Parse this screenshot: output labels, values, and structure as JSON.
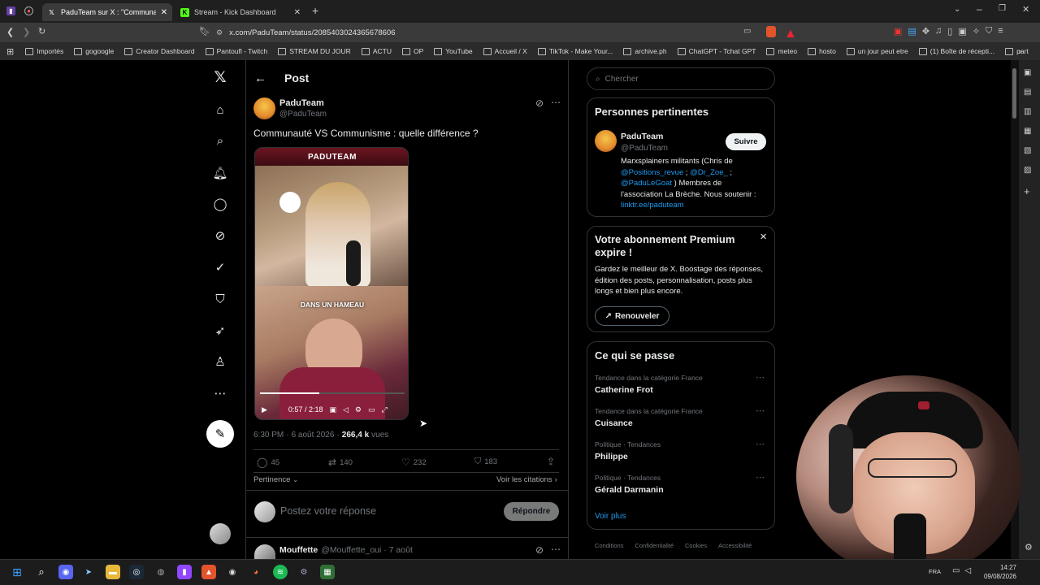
{
  "browser": {
    "tabs": [
      {
        "label": "PaduTeam sur X : \"Communa"
      },
      {
        "label": "Stream - Kick Dashboard"
      }
    ],
    "url": "x.com/PaduTeam/status/2085403024365678606",
    "bookmarks": [
      "Importés",
      "gogoogle",
      "Creator Dashboard",
      "Pantoufl - Twitch",
      "STREAM DU JOUR",
      "ACTU",
      "OP",
      "YouTube",
      "Accueil / X",
      "TikTok - Make Your...",
      "archive.ph",
      "ChatGPT - Tchat GPT",
      "meteo",
      "hosto",
      "un jour peut etre",
      "(1) Boîte de récepti...",
      "part"
    ]
  },
  "post": {
    "header_title": "Post",
    "author_name": "PaduTeam",
    "author_handle": "@PaduTeam",
    "text": "Communauté VS Communisme : quelle différence ?",
    "video_brand": "PADUTEAM",
    "video_caption": "DANS UN HAMEAU",
    "video_time": "0:57 / 2:18",
    "time": "6:30 PM",
    "date": "6 août 2026",
    "views_count": "266,4 k",
    "views_label": "vues",
    "replies": "45",
    "reposts": "140",
    "likes": "232",
    "bookmarks": "183",
    "sort_label": "Pertinence",
    "quotes_label": "Voir les citations",
    "reply_placeholder": "Postez votre réponse",
    "reply_button": "Répondre"
  },
  "next_reply": {
    "author_name": "Mouffette",
    "handle_date": "@Mouffette_oui · 7 août"
  },
  "search": {
    "placeholder": "Chercher"
  },
  "relevant": {
    "title": "Personnes pertinentes",
    "name": "PaduTeam",
    "handle": "@PaduTeam",
    "follow": "Suivre",
    "bio_1": "Marxsplainers militants (Chris de",
    "bio_link_1": "@Positions_revue",
    "bio_sep_1": " ; ",
    "bio_link_2": "@Dr_Zoe_",
    "bio_sep_2": " ;",
    "bio_link_3": "@PaduLeGoat",
    "bio_2": " ) Membres de",
    "bio_3": "l'association La Brèche. Nous soutenir :",
    "bio_link_4": "linktr.ee/paduteam"
  },
  "premium": {
    "title": "Votre abonnement Premium expire !",
    "body": "Gardez le meilleur de X. Boostage des réponses, édition des posts, personnalisation, posts plus longs et bien plus encore.",
    "button": "Renouveler"
  },
  "trends": {
    "title": "Ce qui se passe",
    "items": [
      {
        "context": "Tendance dans la catégorie France",
        "name": "Catherine Frot"
      },
      {
        "context": "Tendance dans la catégorie France",
        "name": "Cuisance"
      },
      {
        "context": "Politique · Tendances",
        "name": "Philippe"
      },
      {
        "context": "Politique · Tendances",
        "name": "Gérald Darmanin"
      }
    ],
    "more": "Voir plus"
  },
  "footer": {
    "links": [
      "Conditions",
      "Confidentialité",
      "Cookies",
      "Accessibilité"
    ]
  },
  "taskbar": {
    "lang": "FRA",
    "time": "14:27",
    "date": "09/08/2026"
  },
  "colors": {
    "accent": "#1d9bf0",
    "bg": "#000000",
    "border": "#2f3336"
  }
}
